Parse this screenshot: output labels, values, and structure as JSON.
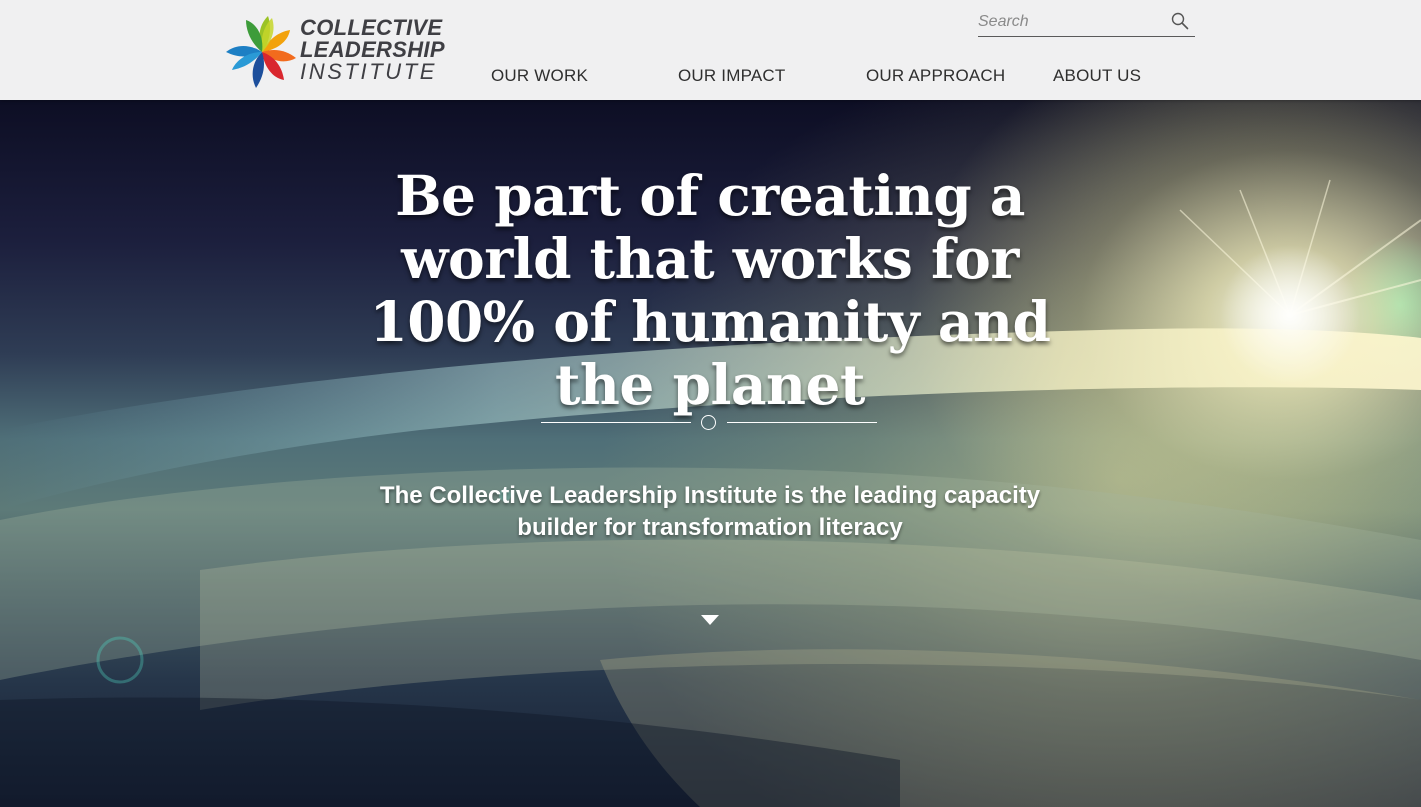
{
  "brand": {
    "name_line1": "COLLECTIVE",
    "name_line2": "LEADERSHIP",
    "name_line3": "INSTITUTE",
    "logo_colors": [
      "#f2a20c",
      "#9bc325",
      "#3d9c3a",
      "#1d7fc4",
      "#1d4f9c",
      "#d9272e",
      "#f26b1d"
    ]
  },
  "search": {
    "placeholder": "Search",
    "icon": "search-icon"
  },
  "nav": {
    "items": [
      {
        "label": "OUR WORK"
      },
      {
        "label": "OUR IMPACT"
      },
      {
        "label": "OUR APPROACH"
      },
      {
        "label": "ABOUT US"
      }
    ]
  },
  "hero": {
    "headline": "Be part of creating a world that works for 100% of humanity and the planet",
    "tagline": "The Collective Leadership Institute is the leading capacity builder for transformation literacy",
    "scroll_icon": "caret-down-icon"
  },
  "colors": {
    "header_bg": "#f0f0f1",
    "nav_text": "#2f2f2f",
    "hero_text": "#ffffff"
  }
}
